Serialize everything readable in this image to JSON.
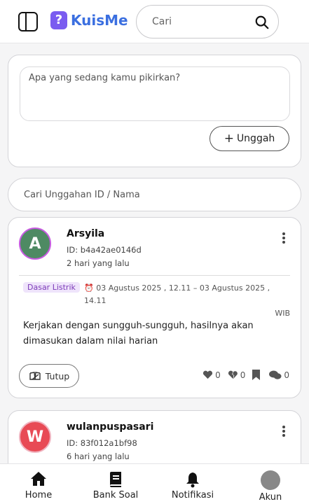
{
  "header": {
    "logo_mark": "?",
    "logo_text": "KuisMe",
    "search_placeholder": "Cari"
  },
  "composer": {
    "placeholder": "Apa yang sedang kamu pikirkan?",
    "upload_label": "Unggah",
    "upload_icon": "plus-icon"
  },
  "post_search": {
    "placeholder": "Cari Unggahan ID / Nama"
  },
  "posts": [
    {
      "avatar_letter": "A",
      "avatar_color": "#4e8a63",
      "author": "Arsyila",
      "id": "ID: b4a42ae0146d",
      "time": "2 hari yang lalu",
      "subject": "Dasar Listrik",
      "schedule": "03 Agustus 2025 , 12.11 – 03 Agustus 2025 , 14.11",
      "schedule_tail": "WIB",
      "body": "Kerjakan dengan sungguh-sungguh, hasilnya akan dimasukan dalam nilai harian",
      "close_label": "Tutup",
      "likes": "0",
      "dislikes": "0",
      "comments": "0"
    },
    {
      "avatar_letter": "W",
      "avatar_color": "#e84a55",
      "author": "wulanpuspasari",
      "id": "ID: 83f012a1bf98",
      "time": "6 hari yang lalu"
    }
  ],
  "nav": {
    "items": [
      {
        "label": "Home",
        "icon": "home-icon"
      },
      {
        "label": "Bank Soal",
        "icon": "book-icon"
      },
      {
        "label": "Notifikasi",
        "icon": "bell-icon"
      },
      {
        "label": "Akun",
        "icon": "account-avatar"
      }
    ]
  },
  "colors": {
    "brand_blue": "#3b6fe0",
    "logo_purple": "#7a5cf0",
    "subject_tag": "#7c3ab8"
  }
}
